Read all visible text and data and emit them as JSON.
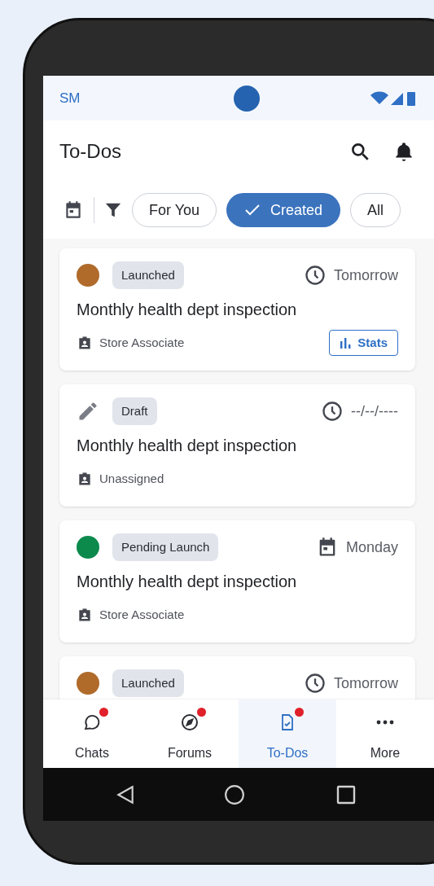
{
  "status_bar": {
    "carrier": "SM"
  },
  "header": {
    "title": "To-Dos"
  },
  "filters": [
    {
      "label": "For You",
      "selected": false
    },
    {
      "label": "Created",
      "selected": true
    },
    {
      "label": "All",
      "selected": false
    }
  ],
  "todos": [
    {
      "kind": "dot",
      "color": "#b06a2a",
      "status": "Launched",
      "due": {
        "kind": "clock",
        "text": "Tomorrow"
      },
      "title": "Monthly health dept inspection",
      "assignee": "Store Associate",
      "action": "Stats"
    },
    {
      "kind": "pencil",
      "status": "Draft",
      "due": {
        "kind": "clock",
        "text": "--/--/----"
      },
      "title": "Monthly health dept inspection",
      "assignee": "Unassigned"
    },
    {
      "kind": "dot",
      "color": "#0b8a4c",
      "status": "Pending Launch",
      "due": {
        "kind": "calendar",
        "text": "Monday"
      },
      "title": "Monthly health dept inspection",
      "assignee": "Store Associate"
    },
    {
      "kind": "dot",
      "color": "#b06a2a",
      "status": "Launched",
      "due": {
        "kind": "clock",
        "text": "Tomorrow"
      }
    }
  ],
  "bottom_nav": [
    {
      "label": "Chats",
      "selected": false,
      "unread": true
    },
    {
      "label": "Forums",
      "selected": false,
      "unread": true
    },
    {
      "label": "To-Dos",
      "selected": true,
      "unread": true
    },
    {
      "label": "More",
      "selected": false,
      "unread": false
    }
  ]
}
